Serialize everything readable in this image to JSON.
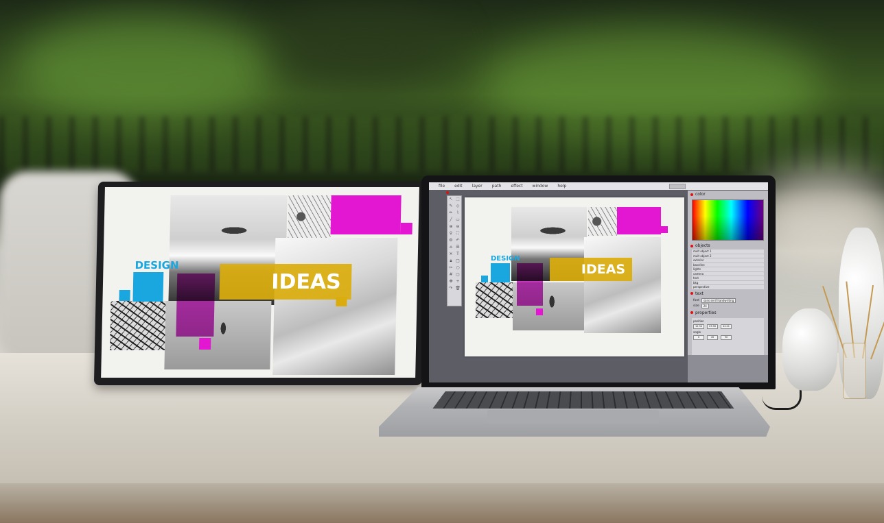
{
  "monitor": {
    "design_text": "DESIGN",
    "ideas_text": "IDEAS"
  },
  "app": {
    "menu": [
      "file",
      "edit",
      "layer",
      "path",
      "effect",
      "window",
      "help"
    ],
    "canvas": {
      "design_text": "DESIGN",
      "ideas_text": "IDEAS"
    },
    "panel": {
      "color_heading": "color",
      "objects_heading": "objects",
      "objects": [
        "mult object 1",
        "mult object 2",
        "exterior",
        "baseline",
        "lights",
        "camera",
        "text",
        "bkg",
        "perspective"
      ],
      "text_heading": "text",
      "font_label": "font",
      "font_value": "sans serif handwriting",
      "size_label": "size",
      "size_value": "24",
      "properties_heading": "properties",
      "position_label": "position",
      "angle_label": "angle",
      "position_values": [
        "12.34",
        "23.56",
        "44.21"
      ],
      "angle_values": [
        "0",
        "45",
        "90"
      ]
    },
    "colors": {
      "magenta": "#e316d1",
      "cyan": "#1aa6df",
      "gold": "#dbac0d"
    }
  }
}
